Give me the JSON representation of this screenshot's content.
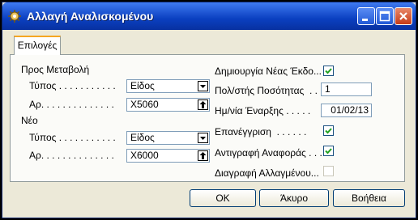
{
  "window": {
    "title": "Αλλαγή Αναλισκομένου"
  },
  "tabs": [
    {
      "label": "Επιλογές"
    }
  ],
  "left": {
    "from_heading": "Προς Μεταβολή",
    "from_type_label": "Τύπος . . . . . . . . . . .",
    "from_type_value": "Είδος",
    "from_no_label": "Αρ. . . . . . . . . . . . . .",
    "from_no_value": "X5060",
    "new_heading": "Νέο",
    "new_type_label": "Τύπος . . . . . . . . . . .",
    "new_type_value": "Είδος",
    "new_no_label": "Αρ. . . . . . . . . . . . . .",
    "new_no_value": "X6000"
  },
  "right": {
    "create_new_label": "Δημιουργία Νέας Έκδο...",
    "create_new_checked": true,
    "qty_multiplier_label": "Πολ/στής Ποσότητας  . .",
    "qty_multiplier_value": "1",
    "start_date_label": "Ημ/νία Έναρξης . . . . .",
    "start_date_value": "01/02/13",
    "recalculate_label": "Επανέγγριση  . . . . . .",
    "recalculate_checked": true,
    "copy_ref_label": "Αντιγραφή Αναφοράς . . .",
    "copy_ref_checked": true,
    "delete_changed_label": "Διαγραφή Αλλαγμένου...",
    "delete_changed_checked": false
  },
  "buttons": {
    "ok": "OK",
    "cancel": "Άκυρο",
    "help": "Βοήθεια"
  },
  "colors": {
    "titlebar": "#0a3fc0",
    "check": "#21a121"
  }
}
